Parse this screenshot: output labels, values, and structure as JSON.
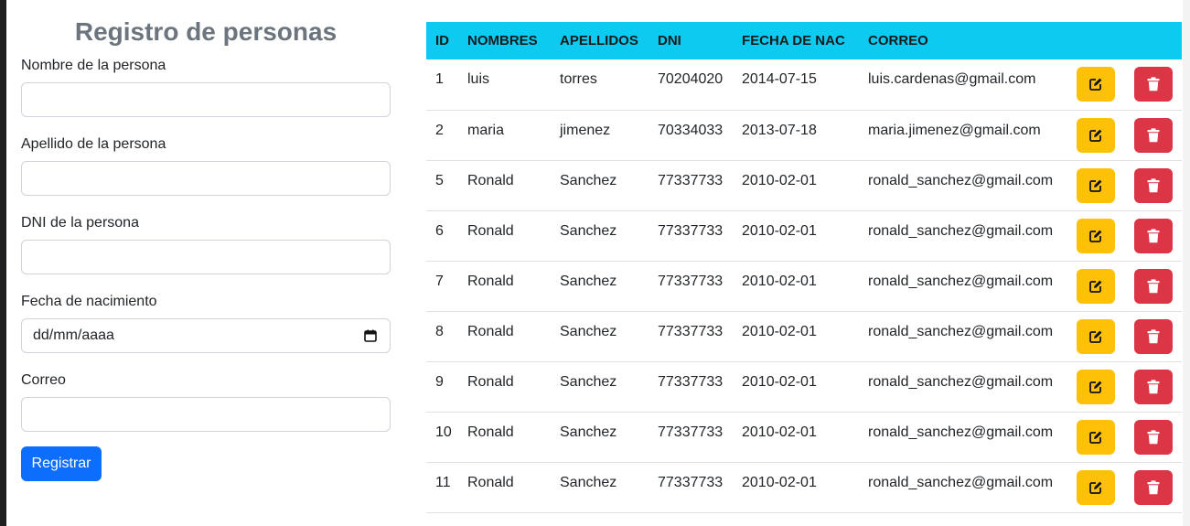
{
  "form": {
    "title": "Registro de personas",
    "fields": [
      {
        "label": "Nombre de la persona",
        "value": ""
      },
      {
        "label": "Apellido de la persona",
        "value": ""
      },
      {
        "label": "DNI de la persona",
        "value": ""
      },
      {
        "label": "Fecha de nacimiento",
        "value": "dd/mm/aaaa"
      },
      {
        "label": "Correo",
        "value": ""
      }
    ],
    "submit_label": "Registrar"
  },
  "table": {
    "headers": [
      "ID",
      "NOMBRES",
      "APELLIDOS",
      "DNI",
      "FECHA DE NAC",
      "CORREO"
    ],
    "rows": [
      {
        "id": "1",
        "nombres": "luis",
        "apellidos": "torres",
        "dni": "70204020",
        "fecha": "2014-07-15",
        "correo": "luis.cardenas@gmail.com"
      },
      {
        "id": "2",
        "nombres": "maria",
        "apellidos": "jimenez",
        "dni": "70334033",
        "fecha": "2013-07-18",
        "correo": "maria.jimenez@gmail.com"
      },
      {
        "id": "5",
        "nombres": "Ronald",
        "apellidos": "Sanchez",
        "dni": "77337733",
        "fecha": "2010-02-01",
        "correo": "ronald_sanchez@gmail.com"
      },
      {
        "id": "6",
        "nombres": "Ronald",
        "apellidos": "Sanchez",
        "dni": "77337733",
        "fecha": "2010-02-01",
        "correo": "ronald_sanchez@gmail.com"
      },
      {
        "id": "7",
        "nombres": "Ronald",
        "apellidos": "Sanchez",
        "dni": "77337733",
        "fecha": "2010-02-01",
        "correo": "ronald_sanchez@gmail.com"
      },
      {
        "id": "8",
        "nombres": "Ronald",
        "apellidos": "Sanchez",
        "dni": "77337733",
        "fecha": "2010-02-01",
        "correo": "ronald_sanchez@gmail.com"
      },
      {
        "id": "9",
        "nombres": "Ronald",
        "apellidos": "Sanchez",
        "dni": "77337733",
        "fecha": "2010-02-01",
        "correo": "ronald_sanchez@gmail.com"
      },
      {
        "id": "10",
        "nombres": "Ronald",
        "apellidos": "Sanchez",
        "dni": "77337733",
        "fecha": "2010-02-01",
        "correo": "ronald_sanchez@gmail.com"
      },
      {
        "id": "11",
        "nombres": "Ronald",
        "apellidos": "Sanchez",
        "dni": "77337733",
        "fecha": "2010-02-01",
        "correo": "ronald_sanchez@gmail.com"
      }
    ],
    "row_actions": [
      {
        "name": "edit",
        "icon": "edit-icon",
        "color": "#ffc107"
      },
      {
        "name": "delete",
        "icon": "trash-icon",
        "color": "#dc3545"
      }
    ]
  },
  "colors": {
    "header_bg": "#0dcaf0",
    "primary": "#0d6efd",
    "title": "#6c757d"
  }
}
